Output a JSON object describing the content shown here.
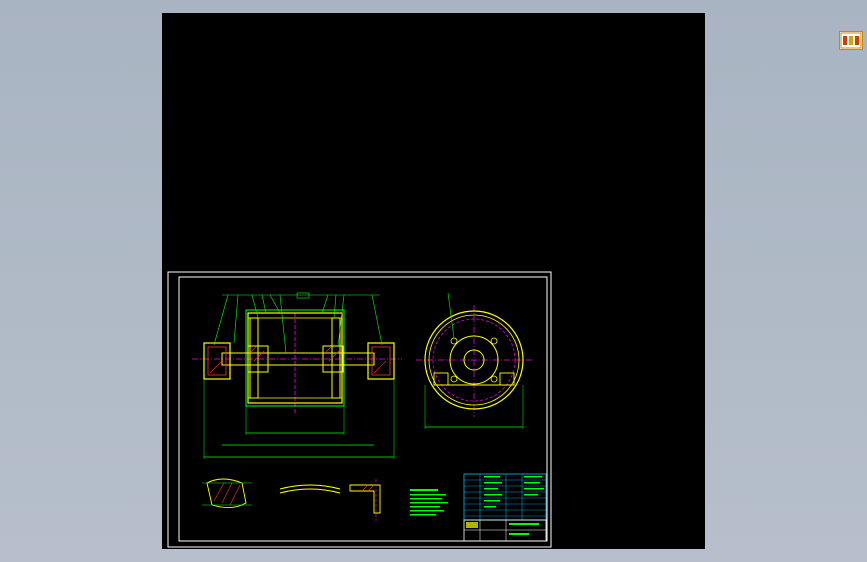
{
  "viewport": {
    "background": "#a9b4c2",
    "canvas_color": "#000000",
    "thumbnail_icon": "drawing-thumbnail-icon"
  },
  "drawing": {
    "colors": {
      "frame": "#ffffff",
      "dimension": "#00ff00",
      "part_outline": "#ffff00",
      "centerline": "#ff00ff",
      "annotation": "#00c0ff",
      "hatch": "#ff3030"
    },
    "views": [
      "front-section-view",
      "side-view",
      "detail-views",
      "notes-block",
      "parts-table",
      "title-block"
    ]
  }
}
